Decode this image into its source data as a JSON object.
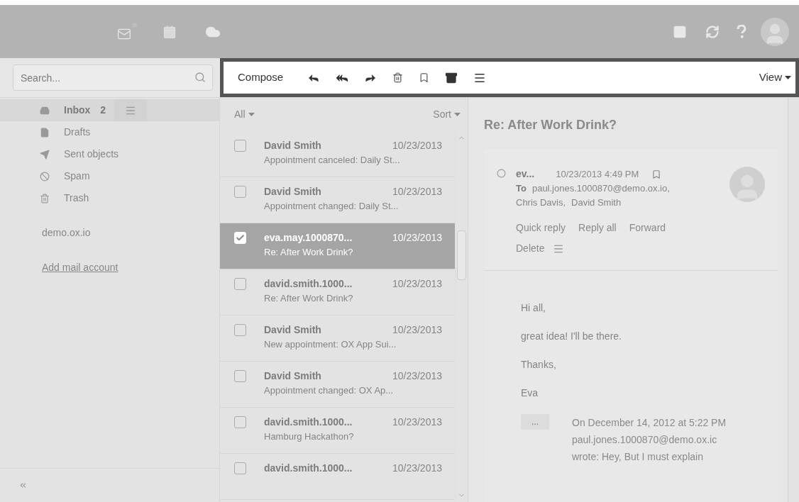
{
  "search": {
    "placeholder": "Search..."
  },
  "toolbar": {
    "compose": "Compose",
    "view": "View"
  },
  "folders": [
    {
      "kind": "inbox",
      "label": "Inbox",
      "count": "2",
      "selected": true
    },
    {
      "kind": "drafts",
      "label": "Drafts",
      "selected": false
    },
    {
      "kind": "sent",
      "label": "Sent objects",
      "selected": false
    },
    {
      "kind": "spam",
      "label": "Spam",
      "selected": false
    },
    {
      "kind": "trash",
      "label": "Trash",
      "selected": false
    }
  ],
  "account": "demo.ox.io",
  "add_account": "Add mail account",
  "list": {
    "filter": "All",
    "sort": "Sort",
    "messages": [
      {
        "sender": "David Smith",
        "date": "10/23/2013",
        "subject": "Appointment canceled: Daily St...",
        "selected": false
      },
      {
        "sender": "David Smith",
        "date": "10/23/2013",
        "subject": "Appointment changed: Daily St...",
        "selected": false
      },
      {
        "sender": "eva.may.1000870...",
        "date": "10/23/2013",
        "subject": "Re: After Work Drink?",
        "selected": true
      },
      {
        "sender": "david.smith.1000...",
        "date": "10/23/2013",
        "subject": "Re: After Work Drink?",
        "selected": false
      },
      {
        "sender": "David Smith",
        "date": "10/23/2013",
        "subject": "New appointment: OX App Sui...",
        "selected": false
      },
      {
        "sender": "David Smith",
        "date": "10/23/2013",
        "subject": "Appointment changed: OX Ap...",
        "selected": false
      },
      {
        "sender": "david.smith.1000...",
        "date": "10/23/2013",
        "subject": "Hamburg Hackathon?",
        "selected": false
      },
      {
        "sender": "david.smith.1000...",
        "date": "10/23/2013",
        "selected": false
      }
    ]
  },
  "detail": {
    "subject": "Re: After Work Drink?",
    "from": "ev...",
    "datetime": "10/23/2013 4:49 PM",
    "to_label": "To",
    "recipients": [
      "paul.jones.1000870@demo.ox.io,",
      "Chris Davis,",
      "David Smith"
    ],
    "actions": [
      "Quick reply",
      "Reply all",
      "Forward",
      "Delete"
    ],
    "body": [
      "Hi all,",
      "great idea! I'll be there.",
      "Thanks,",
      "Eva"
    ],
    "quote_toggle": "...",
    "quote": "On December 14, 2012 at 5:22 PM paul.jones.1000870@demo.ox.ic wrote: Hey, But I must explain"
  }
}
